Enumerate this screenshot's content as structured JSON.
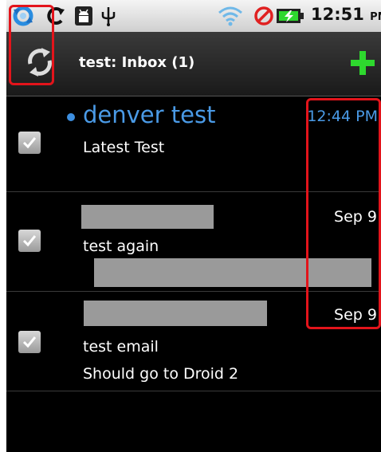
{
  "status_bar": {
    "time": "12:51",
    "ampm": "PM",
    "icons": [
      "sync-icon",
      "refresh-icon",
      "android-icon",
      "usb-icon",
      "wifi-icon",
      "blocked-icon",
      "battery-charging-icon"
    ]
  },
  "header": {
    "title": "test: Inbox (1)",
    "refresh_icon": "refresh-icon",
    "compose_icon": "plus-icon"
  },
  "messages": [
    {
      "sender": "denver test",
      "time": "12:44 PM",
      "subject": "Latest Test",
      "snippet": "",
      "unread": true,
      "checked": true
    },
    {
      "sender": "",
      "time": "Sep 9",
      "subject": "test again",
      "snippet": "",
      "unread": false,
      "checked": true
    },
    {
      "sender": "",
      "time": "Sep 9",
      "subject": "test email",
      "snippet": "Should go to Droid 2",
      "unread": false,
      "checked": true
    }
  ],
  "colors": {
    "unread_accent": "#4a9ae6",
    "compose_green": "#2ed82e",
    "annotation_red": "#e3141b"
  }
}
